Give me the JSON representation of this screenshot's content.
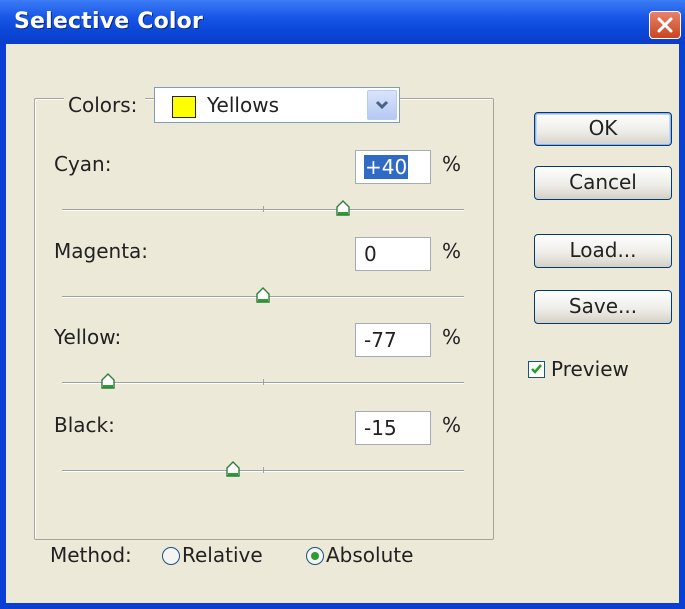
{
  "window": {
    "title": "Selective Color"
  },
  "colors": {
    "label": "Colors:",
    "selected": "Yellows",
    "swatch_color": "#ffff00"
  },
  "sliders": [
    {
      "label": "Cyan:",
      "value": "+40",
      "unit": "%",
      "level": 0.7
    },
    {
      "label": "Magenta:",
      "value": "0",
      "unit": "%",
      "level": 0.5
    },
    {
      "label": "Yellow:",
      "value": "-77",
      "unit": "%",
      "level": 0.115
    },
    {
      "label": "Black:",
      "value": "-15",
      "unit": "%",
      "level": 0.425
    }
  ],
  "buttons": {
    "ok": "OK",
    "cancel": "Cancel",
    "load": "Load...",
    "save": "Save..."
  },
  "preview": {
    "label": "Preview",
    "checked": true
  },
  "method": {
    "label": "Method:",
    "options": [
      {
        "label": "Relative",
        "selected": false
      },
      {
        "label": "Absolute",
        "selected": true
      }
    ]
  },
  "icons": {
    "close": "close-icon",
    "dropdown": "chevron-down-icon",
    "check": "checkmark-icon",
    "thumb": "slider-thumb-icon"
  },
  "colors_theme": {
    "titlebar": "#0a47d8",
    "dialog_bg": "#ece9d8",
    "selection": "#316ac5"
  }
}
